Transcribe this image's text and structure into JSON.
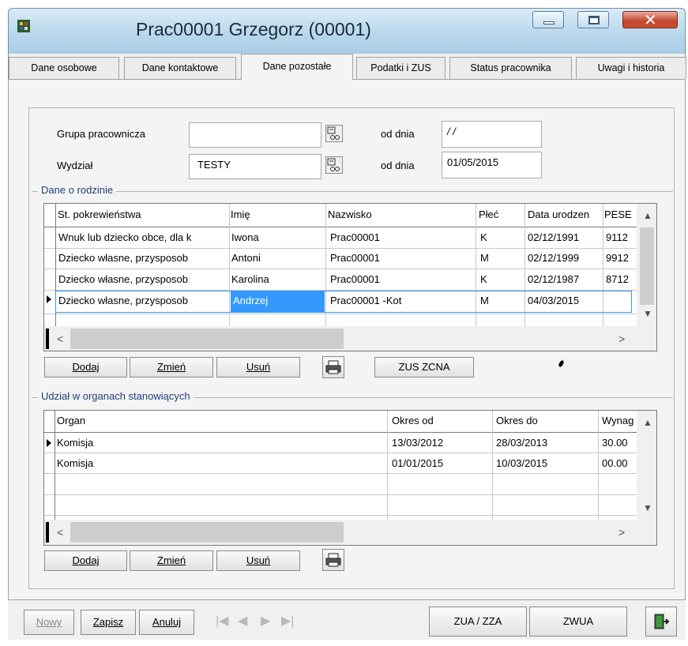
{
  "window": {
    "title": "Prac00001 Grzegorz  (00001)"
  },
  "tabs": [
    "Dane osobowe",
    "Dane kontaktowe",
    "Dane pozostałe",
    "Podatki i ZUS",
    "Status pracownika",
    "Uwagi i historia"
  ],
  "form": {
    "grupa_label": "Grupa pracownicza",
    "grupa_value": "",
    "wydzial_label": "Wydział",
    "wydzial_value": "TESTY",
    "od_dnia_label": "od dnia",
    "grupa_od_dnia": " / /",
    "wydzial_od_dnia": "01/05/2015"
  },
  "family": {
    "group_label": "Dane o rodzinie",
    "headers": [
      "St. pokrewieństwa",
      "Imię",
      "Nazwisko",
      "Płeć",
      "Data urodzen",
      "PESE"
    ],
    "rows": [
      [
        "Wnuk lub dziecko obce, dla k",
        "Iwona",
        "Prac00001",
        "K",
        "02/12/1991",
        "9112"
      ],
      [
        "Dziecko własne, przysposob",
        "Antoni",
        "Prac00001",
        "M",
        "02/12/1999",
        "9912"
      ],
      [
        "Dziecko własne, przysposob",
        "Karolina",
        "Prac00001",
        "K",
        "02/12/1987",
        "8712"
      ],
      [
        "Dziecko własne, przysposob",
        "Andrzej",
        "Prac00001   -Kot",
        "M",
        "04/03/2015",
        ""
      ]
    ],
    "buttons": {
      "add": "Dodaj",
      "edit": "Zmień",
      "delete": "Usuń",
      "zus": "ZUS ZCNA"
    }
  },
  "organs": {
    "group_label": "Udział w organach stanowiących",
    "headers": [
      "Organ",
      "Okres od",
      "Okres do",
      "Wynag"
    ],
    "rows": [
      [
        "Komisja",
        "13/03/2012",
        "28/03/2013",
        "30.00"
      ],
      [
        "Komisja",
        "01/01/2015",
        "10/03/2015",
        "00.00"
      ]
    ],
    "buttons": {
      "add": "Dodaj",
      "edit": "Zmień",
      "delete": "Usuń"
    }
  },
  "bottom": {
    "new": "Nowy",
    "save": "Zapisz",
    "cancel": "Anuluj",
    "zua": "ZUA / ZZA",
    "zwua": "ZWUA"
  },
  "colors": {
    "selection": "#3399ff",
    "accent": "#1f3f7a"
  }
}
